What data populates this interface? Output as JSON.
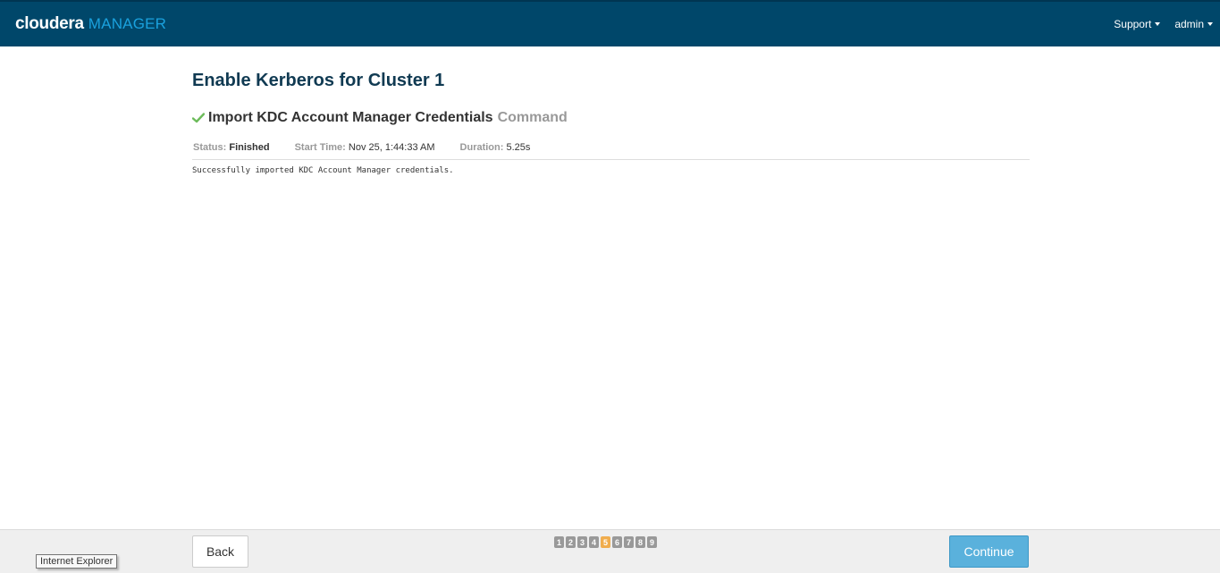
{
  "header": {
    "brand": "cloudera",
    "product": "MANAGER",
    "nav": [
      {
        "label": "Support"
      },
      {
        "label": "admin"
      }
    ],
    "colors": {
      "bar": "#00476a",
      "product_accent": "#1aa1dd"
    }
  },
  "main": {
    "page_title": "Enable Kerberos for Cluster 1",
    "command": {
      "status_icon": "check-icon",
      "name": "Import KDC Account Manager Credentials",
      "suffix": "Command"
    },
    "status": {
      "status_label": "Status:",
      "status_value": "Finished",
      "start_label": "Start Time:",
      "start_value": "Nov 25, 1:44:33 AM",
      "duration_label": "Duration:",
      "duration_value": "5.25s"
    },
    "log": "Successfully imported KDC Account Manager credentials."
  },
  "footer": {
    "back_label": "Back",
    "continue_label": "Continue",
    "steps": [
      "1",
      "2",
      "3",
      "4",
      "5",
      "6",
      "7",
      "8",
      "9"
    ],
    "active_step": "5",
    "colors": {
      "continue": "#5ab1dc",
      "active_step": "#f0ad4e"
    }
  },
  "tooltip": {
    "text": "Internet Explorer"
  }
}
